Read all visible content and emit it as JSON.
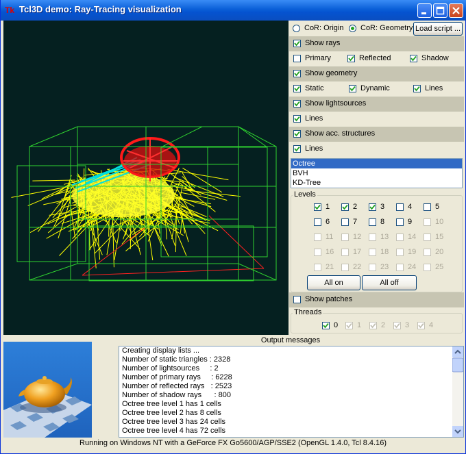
{
  "window": {
    "title": "Tcl3D demo: Ray-Tracing visualization",
    "app_icon": "Tk",
    "controls": [
      "minimize-icon",
      "maximize-icon",
      "close-icon"
    ],
    "accent": "#0a5fd8"
  },
  "cor": {
    "origin_label": "CoR: Origin",
    "geometry_label": "CoR: Geometry",
    "selected": "geometry",
    "load_button": "Load script ..."
  },
  "rays": {
    "header": "Show rays",
    "header_checked": true,
    "primary": "Primary",
    "primary_checked": false,
    "reflected": "Reflected",
    "reflected_checked": true,
    "shadow": "Shadow",
    "shadow_checked": true
  },
  "geometry": {
    "header": "Show geometry",
    "header_checked": true,
    "static": "Static",
    "static_checked": true,
    "dynamic": "Dynamic",
    "dynamic_checked": true,
    "lines": "Lines",
    "lines_checked": true
  },
  "lightsources": {
    "header": "Show lightsources",
    "header_checked": true,
    "lines": "Lines",
    "lines_checked": true
  },
  "acc": {
    "header": "Show acc. structures",
    "header_checked": true,
    "lines": "Lines",
    "lines_checked": true,
    "structures": [
      "Octree",
      "BVH",
      "KD-Tree"
    ],
    "selected_index": 0
  },
  "levels": {
    "title": "Levels",
    "items": [
      {
        "label": "1",
        "checked": true,
        "enabled": true
      },
      {
        "label": "2",
        "checked": true,
        "enabled": true
      },
      {
        "label": "3",
        "checked": true,
        "enabled": true
      },
      {
        "label": "4",
        "checked": false,
        "enabled": true
      },
      {
        "label": "5",
        "checked": false,
        "enabled": true
      },
      {
        "label": "6",
        "checked": false,
        "enabled": true
      },
      {
        "label": "7",
        "checked": false,
        "enabled": true
      },
      {
        "label": "8",
        "checked": false,
        "enabled": true
      },
      {
        "label": "9",
        "checked": false,
        "enabled": true
      },
      {
        "label": "10",
        "checked": false,
        "enabled": false
      },
      {
        "label": "11",
        "checked": false,
        "enabled": false
      },
      {
        "label": "12",
        "checked": false,
        "enabled": false
      },
      {
        "label": "13",
        "checked": false,
        "enabled": false
      },
      {
        "label": "14",
        "checked": false,
        "enabled": false
      },
      {
        "label": "15",
        "checked": false,
        "enabled": false
      },
      {
        "label": "16",
        "checked": false,
        "enabled": false
      },
      {
        "label": "17",
        "checked": false,
        "enabled": false
      },
      {
        "label": "18",
        "checked": false,
        "enabled": false
      },
      {
        "label": "19",
        "checked": false,
        "enabled": false
      },
      {
        "label": "20",
        "checked": false,
        "enabled": false
      },
      {
        "label": "21",
        "checked": false,
        "enabled": false
      },
      {
        "label": "22",
        "checked": false,
        "enabled": false
      },
      {
        "label": "23",
        "checked": false,
        "enabled": false
      },
      {
        "label": "24",
        "checked": false,
        "enabled": false
      },
      {
        "label": "25",
        "checked": false,
        "enabled": false
      }
    ],
    "all_on": "All on",
    "all_off": "All off"
  },
  "patches": {
    "label": "Show patches",
    "checked": false
  },
  "threads": {
    "title": "Threads",
    "items": [
      {
        "label": "0",
        "checked": true,
        "enabled": true
      },
      {
        "label": "1",
        "checked": true,
        "enabled": false
      },
      {
        "label": "2",
        "checked": true,
        "enabled": false
      },
      {
        "label": "3",
        "checked": true,
        "enabled": false
      },
      {
        "label": "4",
        "checked": true,
        "enabled": false
      }
    ]
  },
  "output": {
    "header": "Output messages",
    "lines": [
      "Creating display lists ...",
      "Number of static triangles : 2328",
      "Number of lightsources     : 2",
      "Number of primary rays     : 6228",
      "Number of reflected rays   : 2523",
      "Number of shadow rays      : 800",
      "Octree tree level 1 has 1 cells",
      "Octree tree level 2 has 8 cells",
      "Octree tree level 3 has 24 cells",
      "Octree tree level 4 has 72 cells"
    ]
  },
  "status": "Running on Windows NT with a GeForce FX Go5600/AGP/SSE2 (OpenGL 1.4.0, Tcl 8.4.16)",
  "colors": {
    "viewport_bg": "#052020",
    "octree_lines": "#2fd22f",
    "shadow_rays": "#ffff00",
    "reflected_rays": "#ff0000",
    "light_lines": "#00e0e0",
    "section_bg": "#c7c5b2"
  }
}
